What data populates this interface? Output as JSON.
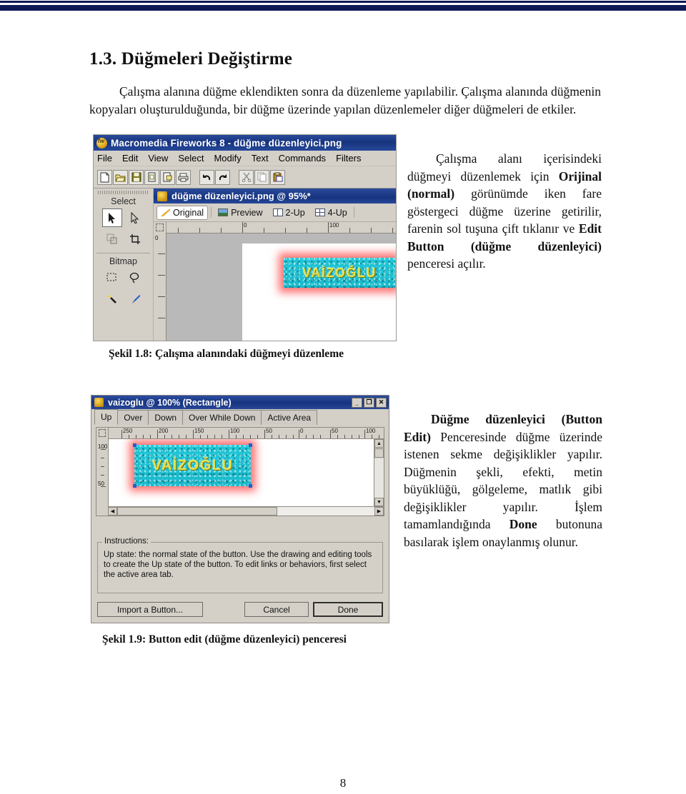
{
  "document": {
    "page_number": "8",
    "heading": "1.3. Düğmeleri Değiştirme",
    "intro_paragraph": "Çalışma alanına düğme eklendikten sonra da düzenleme yapılabilir. Çalışma alanında düğmenin kopyaları oluşturulduğunda, bir düğme üzerinde yapılan düzenlemeler diğer düğmeleri de etkiler."
  },
  "figure1": {
    "caption": "Şekil 1.8: Çalışma alanındaki düğmeyi düzenleme",
    "window_title": "Macromedia Fireworks 8 - düğme düzenleyici.png",
    "menu": [
      "File",
      "Edit",
      "View",
      "Select",
      "Modify",
      "Text",
      "Commands",
      "Filters"
    ],
    "toolbar_icons": [
      "new-document-icon",
      "open-folder-icon",
      "save-disk-icon",
      "import-icon",
      "export-icon",
      "print-icon",
      "undo-arrow-icon",
      "redo-arrow-icon",
      "cut-scissors-icon",
      "copy-icon",
      "paste-icon"
    ],
    "tool_sections": [
      {
        "label": "Select",
        "tools": [
          "pointer-tool-icon",
          "subselection-tool-icon",
          "scale-tool-icon",
          "crop-tool-icon"
        ]
      },
      {
        "label": "Bitmap",
        "tools": [
          "marquee-tool-icon",
          "lasso-tool-icon",
          "magic-wand-tool-icon",
          "brush-tool-icon"
        ]
      }
    ],
    "document_tab_title": "düğme düzenleyici.png @  95%*",
    "view_tabs": [
      {
        "label": "Original",
        "icon": "pencil-icon",
        "selected": true
      },
      {
        "label": "Preview",
        "icon": "image-icon",
        "selected": false
      },
      {
        "label": "2-Up",
        "icon": "two-up-icon",
        "selected": false
      },
      {
        "label": "4-Up",
        "icon": "four-up-icon",
        "selected": false
      }
    ],
    "ruler_h_labels": [
      "0",
      "100"
    ],
    "ruler_v_labels": [
      "0"
    ],
    "button_label": "VAİZOĞLU",
    "colors": {
      "button_fill": "#1ec8d8",
      "button_glow": "#ff5c5c",
      "button_text": "#e9e24a",
      "titlebar": "#16337e"
    },
    "side_text_runs": [
      {
        "text": "Çalışma alanı içerisindeki düğmeyi düzenlemek için ",
        "bold": false
      },
      {
        "text": "Orijinal (normal)",
        "bold": true
      },
      {
        "text": " görünümde iken fare göstergeci düğme üzerine getirilir, farenin sol tuşuna çift tıklanır ve ",
        "bold": false
      },
      {
        "text": "Edit Button (düğme düzenleyici)",
        "bold": true
      },
      {
        "text": " penceresi açılır.",
        "bold": false
      }
    ]
  },
  "figure2": {
    "caption": "Şekil 1.9: Button edit (düğme düzenleyici) penceresi",
    "window_title": "vaizoglu @ 100% (Rectangle)",
    "window_controls": [
      "minimize-button",
      "maximize-button",
      "close-button"
    ],
    "control_glyphs": {
      "minimize": "_",
      "maximize": "❐",
      "close": "✕"
    },
    "tabs": [
      {
        "label": "Up",
        "selected": true
      },
      {
        "label": "Over",
        "selected": false
      },
      {
        "label": "Down",
        "selected": false
      },
      {
        "label": "Over While Down",
        "selected": false
      },
      {
        "label": "Active Area",
        "selected": false
      }
    ],
    "ruler_h_labels": [
      "250",
      "200",
      "150",
      "100",
      "50",
      "0",
      "50",
      "100"
    ],
    "ruler_v_labels": [
      "100",
      "50"
    ],
    "button_label": "VAİZOĞLU",
    "instructions_legend": "Instructions:",
    "instructions_text": "Up state: the normal state of the button. Use the drawing and editing tools to create the Up state of the button. To edit links or behaviors, first select the active area tab.",
    "buttons": {
      "import": "Import a Button...",
      "cancel": "Cancel",
      "done": "Done"
    },
    "side_text_runs": [
      {
        "text": "Düğme düzenleyici (Button Edit)",
        "bold": true
      },
      {
        "text": " Penceresinde düğme üzerinde istenen sekme değişiklikler yapılır. Düğmenin şekli, efekti, metin büyüklüğü, gölgeleme, matlık gibi değişiklikler yapılır. İşlem tamamlandığında ",
        "bold": false
      },
      {
        "text": "Done",
        "bold": true
      },
      {
        "text": " butonuna basılarak işlem onaylanmış olunur.",
        "bold": false
      }
    ]
  }
}
